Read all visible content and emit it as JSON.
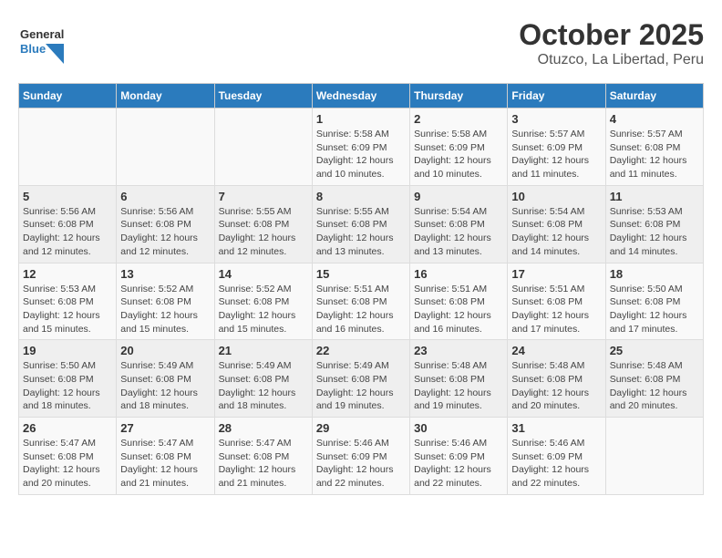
{
  "header": {
    "logo_general": "General",
    "logo_blue": "Blue",
    "title": "October 2025",
    "subtitle": "Otuzco, La Libertad, Peru"
  },
  "days_of_week": [
    "Sunday",
    "Monday",
    "Tuesday",
    "Wednesday",
    "Thursday",
    "Friday",
    "Saturday"
  ],
  "weeks": [
    [
      {
        "day": "",
        "info": ""
      },
      {
        "day": "",
        "info": ""
      },
      {
        "day": "",
        "info": ""
      },
      {
        "day": "1",
        "info": "Sunrise: 5:58 AM\nSunset: 6:09 PM\nDaylight: 12 hours\nand 10 minutes."
      },
      {
        "day": "2",
        "info": "Sunrise: 5:58 AM\nSunset: 6:09 PM\nDaylight: 12 hours\nand 10 minutes."
      },
      {
        "day": "3",
        "info": "Sunrise: 5:57 AM\nSunset: 6:09 PM\nDaylight: 12 hours\nand 11 minutes."
      },
      {
        "day": "4",
        "info": "Sunrise: 5:57 AM\nSunset: 6:08 PM\nDaylight: 12 hours\nand 11 minutes."
      }
    ],
    [
      {
        "day": "5",
        "info": "Sunrise: 5:56 AM\nSunset: 6:08 PM\nDaylight: 12 hours\nand 12 minutes."
      },
      {
        "day": "6",
        "info": "Sunrise: 5:56 AM\nSunset: 6:08 PM\nDaylight: 12 hours\nand 12 minutes."
      },
      {
        "day": "7",
        "info": "Sunrise: 5:55 AM\nSunset: 6:08 PM\nDaylight: 12 hours\nand 12 minutes."
      },
      {
        "day": "8",
        "info": "Sunrise: 5:55 AM\nSunset: 6:08 PM\nDaylight: 12 hours\nand 13 minutes."
      },
      {
        "day": "9",
        "info": "Sunrise: 5:54 AM\nSunset: 6:08 PM\nDaylight: 12 hours\nand 13 minutes."
      },
      {
        "day": "10",
        "info": "Sunrise: 5:54 AM\nSunset: 6:08 PM\nDaylight: 12 hours\nand 14 minutes."
      },
      {
        "day": "11",
        "info": "Sunrise: 5:53 AM\nSunset: 6:08 PM\nDaylight: 12 hours\nand 14 minutes."
      }
    ],
    [
      {
        "day": "12",
        "info": "Sunrise: 5:53 AM\nSunset: 6:08 PM\nDaylight: 12 hours\nand 15 minutes."
      },
      {
        "day": "13",
        "info": "Sunrise: 5:52 AM\nSunset: 6:08 PM\nDaylight: 12 hours\nand 15 minutes."
      },
      {
        "day": "14",
        "info": "Sunrise: 5:52 AM\nSunset: 6:08 PM\nDaylight: 12 hours\nand 15 minutes."
      },
      {
        "day": "15",
        "info": "Sunrise: 5:51 AM\nSunset: 6:08 PM\nDaylight: 12 hours\nand 16 minutes."
      },
      {
        "day": "16",
        "info": "Sunrise: 5:51 AM\nSunset: 6:08 PM\nDaylight: 12 hours\nand 16 minutes."
      },
      {
        "day": "17",
        "info": "Sunrise: 5:51 AM\nSunset: 6:08 PM\nDaylight: 12 hours\nand 17 minutes."
      },
      {
        "day": "18",
        "info": "Sunrise: 5:50 AM\nSunset: 6:08 PM\nDaylight: 12 hours\nand 17 minutes."
      }
    ],
    [
      {
        "day": "19",
        "info": "Sunrise: 5:50 AM\nSunset: 6:08 PM\nDaylight: 12 hours\nand 18 minutes."
      },
      {
        "day": "20",
        "info": "Sunrise: 5:49 AM\nSunset: 6:08 PM\nDaylight: 12 hours\nand 18 minutes."
      },
      {
        "day": "21",
        "info": "Sunrise: 5:49 AM\nSunset: 6:08 PM\nDaylight: 12 hours\nand 18 minutes."
      },
      {
        "day": "22",
        "info": "Sunrise: 5:49 AM\nSunset: 6:08 PM\nDaylight: 12 hours\nand 19 minutes."
      },
      {
        "day": "23",
        "info": "Sunrise: 5:48 AM\nSunset: 6:08 PM\nDaylight: 12 hours\nand 19 minutes."
      },
      {
        "day": "24",
        "info": "Sunrise: 5:48 AM\nSunset: 6:08 PM\nDaylight: 12 hours\nand 20 minutes."
      },
      {
        "day": "25",
        "info": "Sunrise: 5:48 AM\nSunset: 6:08 PM\nDaylight: 12 hours\nand 20 minutes."
      }
    ],
    [
      {
        "day": "26",
        "info": "Sunrise: 5:47 AM\nSunset: 6:08 PM\nDaylight: 12 hours\nand 20 minutes."
      },
      {
        "day": "27",
        "info": "Sunrise: 5:47 AM\nSunset: 6:08 PM\nDaylight: 12 hours\nand 21 minutes."
      },
      {
        "day": "28",
        "info": "Sunrise: 5:47 AM\nSunset: 6:08 PM\nDaylight: 12 hours\nand 21 minutes."
      },
      {
        "day": "29",
        "info": "Sunrise: 5:46 AM\nSunset: 6:09 PM\nDaylight: 12 hours\nand 22 minutes."
      },
      {
        "day": "30",
        "info": "Sunrise: 5:46 AM\nSunset: 6:09 PM\nDaylight: 12 hours\nand 22 minutes."
      },
      {
        "day": "31",
        "info": "Sunrise: 5:46 AM\nSunset: 6:09 PM\nDaylight: 12 hours\nand 22 minutes."
      },
      {
        "day": "",
        "info": ""
      }
    ]
  ]
}
